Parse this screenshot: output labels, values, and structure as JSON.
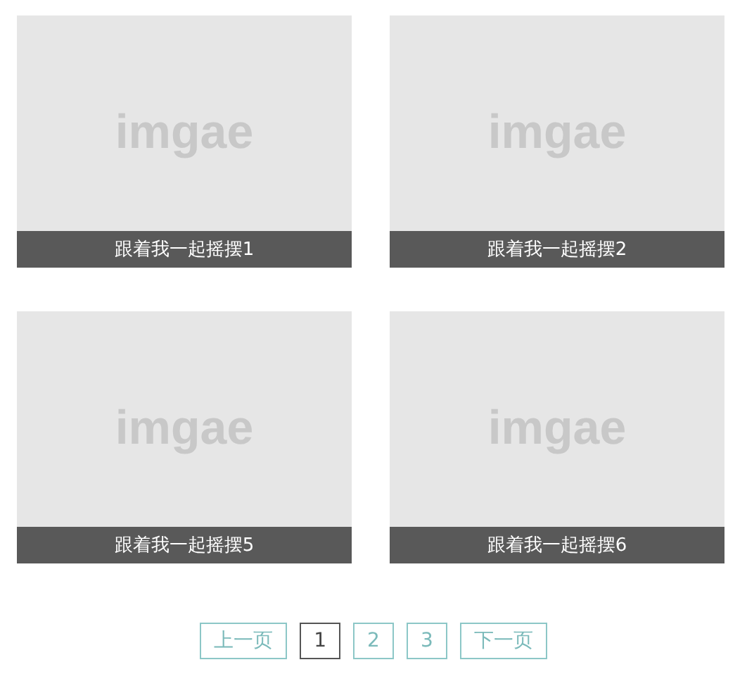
{
  "cards": [
    {
      "image_text": "imgae",
      "caption": "跟着我一起摇摆1"
    },
    {
      "image_text": "imgae",
      "caption": "跟着我一起摇摆2"
    },
    {
      "image_text": "imgae",
      "caption": "跟着我一起摇摆5"
    },
    {
      "image_text": "imgae",
      "caption": "跟着我一起摇摆6"
    }
  ],
  "pagination": {
    "prev": "上一页",
    "pages": [
      {
        "label": "1",
        "selected": true
      },
      {
        "label": "2",
        "selected": false
      },
      {
        "label": "3",
        "selected": false
      }
    ],
    "next": "下一页"
  }
}
